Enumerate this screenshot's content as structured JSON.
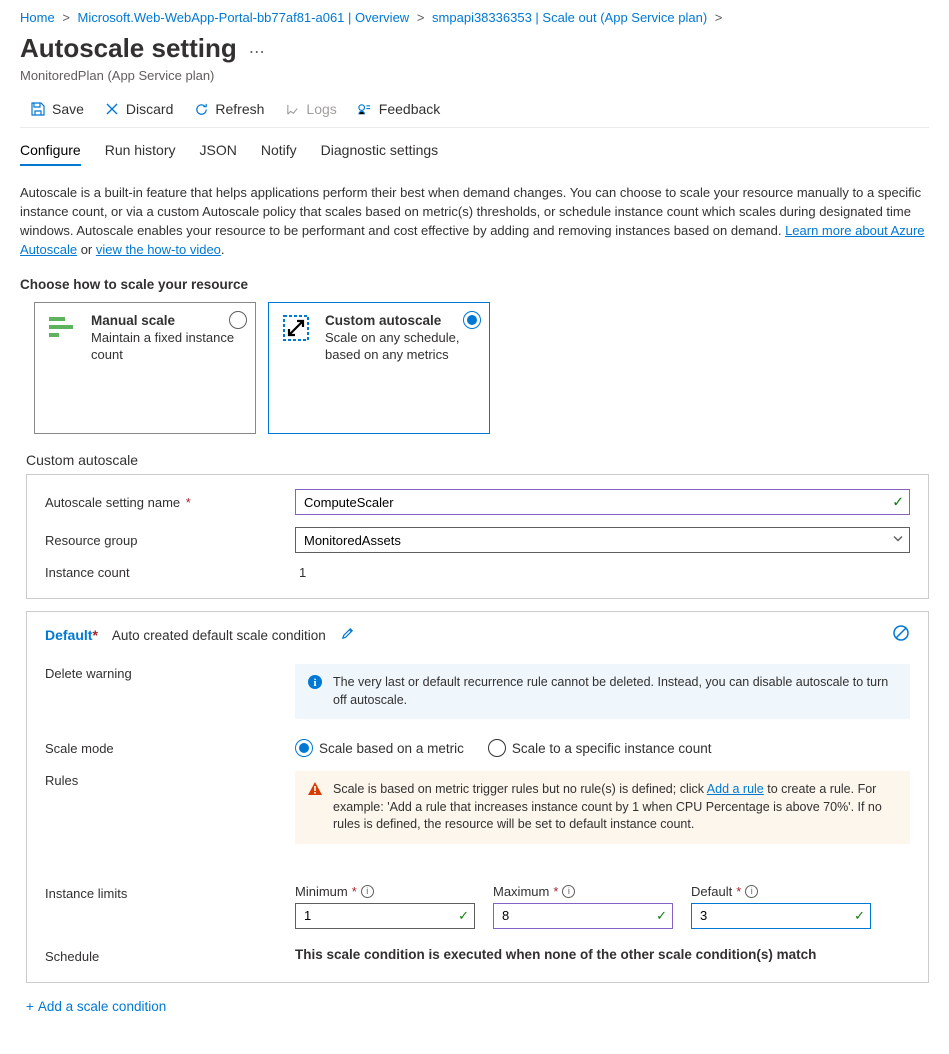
{
  "breadcrumb": {
    "items": [
      {
        "label": "Home"
      },
      {
        "label": "Microsoft.Web-WebApp-Portal-bb77af81-a061 | Overview"
      },
      {
        "label": "smpapi38336353 | Scale out (App Service plan)"
      }
    ]
  },
  "header": {
    "title": "Autoscale setting",
    "subtitle": "MonitoredPlan (App Service plan)"
  },
  "toolbar": {
    "save": "Save",
    "discard": "Discard",
    "refresh": "Refresh",
    "logs": "Logs",
    "feedback": "Feedback"
  },
  "tabs": {
    "items": [
      "Configure",
      "Run history",
      "JSON",
      "Notify",
      "Diagnostic settings"
    ],
    "active": 0
  },
  "intro": {
    "text_a": "Autoscale is a built-in feature that helps applications perform their best when demand changes. You can choose to scale your resource manually to a specific instance count, or via a custom Autoscale policy that scales based on metric(s) thresholds, or schedule instance count which scales during designated time windows. Autoscale enables your resource to be performant and cost effective by adding and removing instances based on demand. ",
    "link1": "Learn more about Azure Autoscale",
    "mid": " or ",
    "link2": "view the how-to video",
    "end": "."
  },
  "scale_choice": {
    "heading": "Choose how to scale your resource",
    "cards": [
      {
        "title": "Manual scale",
        "desc": "Maintain a fixed instance count"
      },
      {
        "title": "Custom autoscale",
        "desc": "Scale on any schedule, based on any metrics"
      }
    ]
  },
  "custom": {
    "title": "Custom autoscale",
    "setting_name_label": "Autoscale setting name",
    "setting_name_value": "ComputeScaler",
    "rg_label": "Resource group",
    "rg_value": "MonitoredAssets",
    "instance_count_label": "Instance count",
    "instance_count_value": "1"
  },
  "condition": {
    "title": "Default",
    "desc": "Auto created default scale condition",
    "delete_warning_label": "Delete warning",
    "delete_warning_text": "The very last or default recurrence rule cannot be deleted. Instead, you can disable autoscale to turn off autoscale.",
    "scale_mode_label": "Scale mode",
    "scale_mode_metric": "Scale based on a metric",
    "scale_mode_specific": "Scale to a specific instance count",
    "rules_label": "Rules",
    "rules_text_a": "Scale is based on metric trigger rules but no rule(s) is defined; click ",
    "rules_link": "Add a rule",
    "rules_text_b": " to create a rule. For example: 'Add a rule that increases instance count by 1 when CPU Percentage is above 70%'. If no rules is defined, the resource will be set to default instance count.",
    "limits_label": "Instance limits",
    "limits": {
      "min_label": "Minimum",
      "min_value": "1",
      "max_label": "Maximum",
      "max_value": "8",
      "def_label": "Default",
      "def_value": "3"
    },
    "schedule_label": "Schedule",
    "schedule_text": "This scale condition is executed when none of the other scale condition(s) match"
  },
  "add_condition": "Add a scale condition"
}
